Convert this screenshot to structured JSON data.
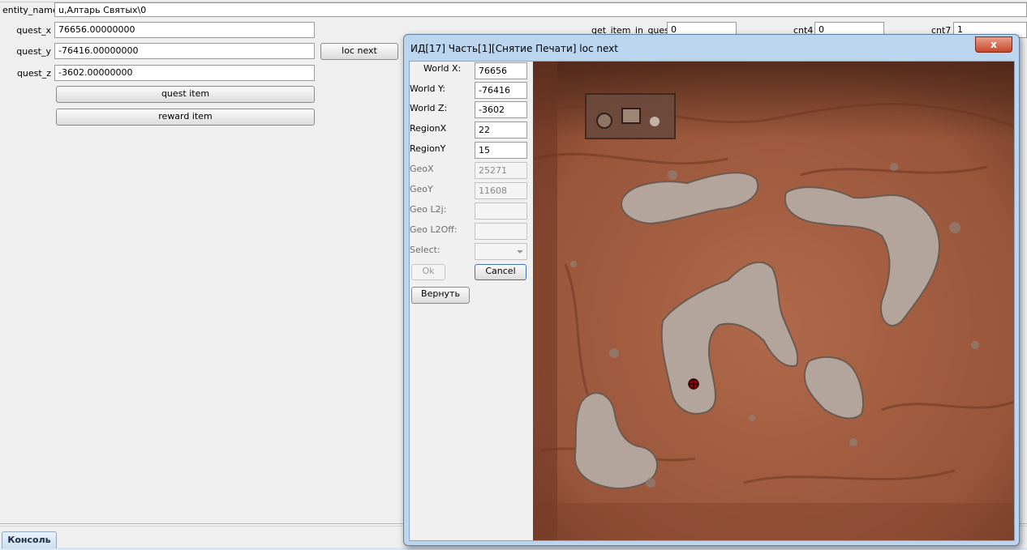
{
  "form": {
    "entity_name_label": "entity_name",
    "entity_name_value": "u,Алтарь Святых\\0",
    "quest_x_label": "quest_x",
    "quest_x_value": "76656.00000000",
    "quest_y_label": "quest_y",
    "quest_y_value": "-76416.00000000",
    "quest_z_label": "quest_z",
    "quest_z_value": "-3602.00000000",
    "loc_next_label": "loc next",
    "quest_item_label": "quest item",
    "reward_item_label": "reward item",
    "get_item_in_quest_label": "get_item_in_quest",
    "get_item_in_quest_value": "0",
    "cnt4_label": "cnt4",
    "cnt4_value": "0",
    "cnt7_label": "cnt7",
    "cnt7_value": "1"
  },
  "dialog": {
    "title": "ИД[17] Часть[1][Снятие Печати] loc next",
    "close_glyph": "x",
    "world_x_label": "World X:",
    "world_x_value": "76656",
    "world_y_label": "World Y:",
    "world_y_value": "-76416",
    "world_z_label": "World Z:",
    "world_z_value": "-3602",
    "region_x_label": "RegionX",
    "region_x_value": "22",
    "region_y_label": "RegionY",
    "region_y_value": "15",
    "geo_x_label": "GeoX",
    "geo_x_value": "25271",
    "geo_y_label": "GeoY",
    "geo_y_value": "11608",
    "geo_l2j_label": "Geo L2j:",
    "geo_l2j_value": "",
    "geo_l2off_label": "Geo L2Off:",
    "geo_l2off_value": "",
    "select_label": "Select:",
    "ok_label": "Ok",
    "cancel_label": "Cancel",
    "return_label": "Вернуть"
  },
  "bottom_tab": {
    "label": "Консоль"
  },
  "icons": [
    "close-icon",
    "chevron-down-icon",
    "crosshair-marker-icon"
  ],
  "colors": {
    "dialog_frame": "#bcd5ee",
    "close_button": "#c8452b",
    "map_terrain": "#9a5a3c",
    "marker": "#8b0000"
  }
}
